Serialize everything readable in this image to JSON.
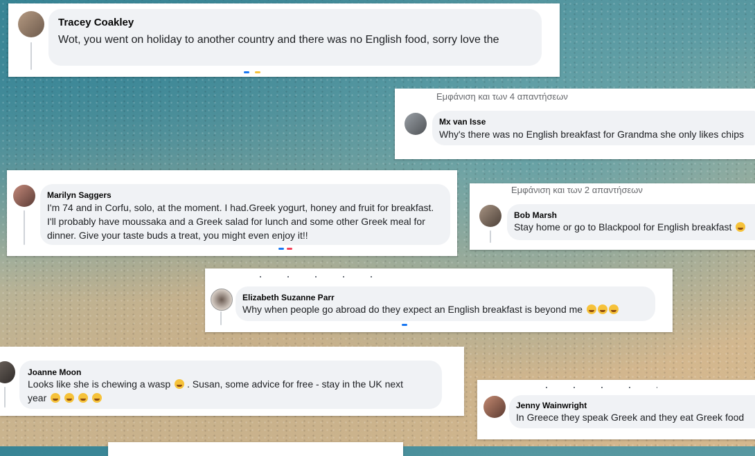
{
  "comments": {
    "tracey": {
      "name": "Tracey Coakley",
      "text": "Wot, you went on holiday to another country and there was no English food, sorry love the"
    },
    "mx": {
      "replies_link": "Εμφάνιση και των 4 απαντήσεων",
      "name": "Mx van Isse",
      "text": "Why's there was no English breakfast for Grandma she only likes chips"
    },
    "marilyn": {
      "name": "Marilyn Saggers",
      "text": "I'm 74 and in Corfu, solo, at the moment. I had.Greek yogurt, honey and fruit for breakfast. I'll probably have moussaka and a Greek salad for lunch and some other Greek meal for dinner. Give your taste buds a treat, you might even enjoy it!!"
    },
    "bob": {
      "replies_link": "Εμφάνιση και των 2 απαντήσεων",
      "name": "Bob Marsh",
      "text": "Stay home or go to Blackpool for English breakfast"
    },
    "elizabeth": {
      "name": "Elizabeth Suzanne Parr",
      "text": "Why when people go abroad do they expect an English breakfast is beyond me"
    },
    "joanne": {
      "name": "Joanne Moon",
      "text_line1": "Looks like she is chewing a wasp",
      "text_line1b": ". Susan, some advice for free - stay in the UK next",
      "text_line2": "year"
    },
    "jenny": {
      "name": "Jenny Wainwright",
      "text": "In Greece they speak Greek and they eat Greek food"
    }
  },
  "colors": {
    "bubble": "#f0f2f5",
    "reaction_blue": "#1877f2",
    "reaction_red": "#f33e58",
    "emoji_yellow": "#f6c23a"
  },
  "icons": [
    "avatar-photo",
    "laughing-emoji",
    "smiling-emoji"
  ]
}
